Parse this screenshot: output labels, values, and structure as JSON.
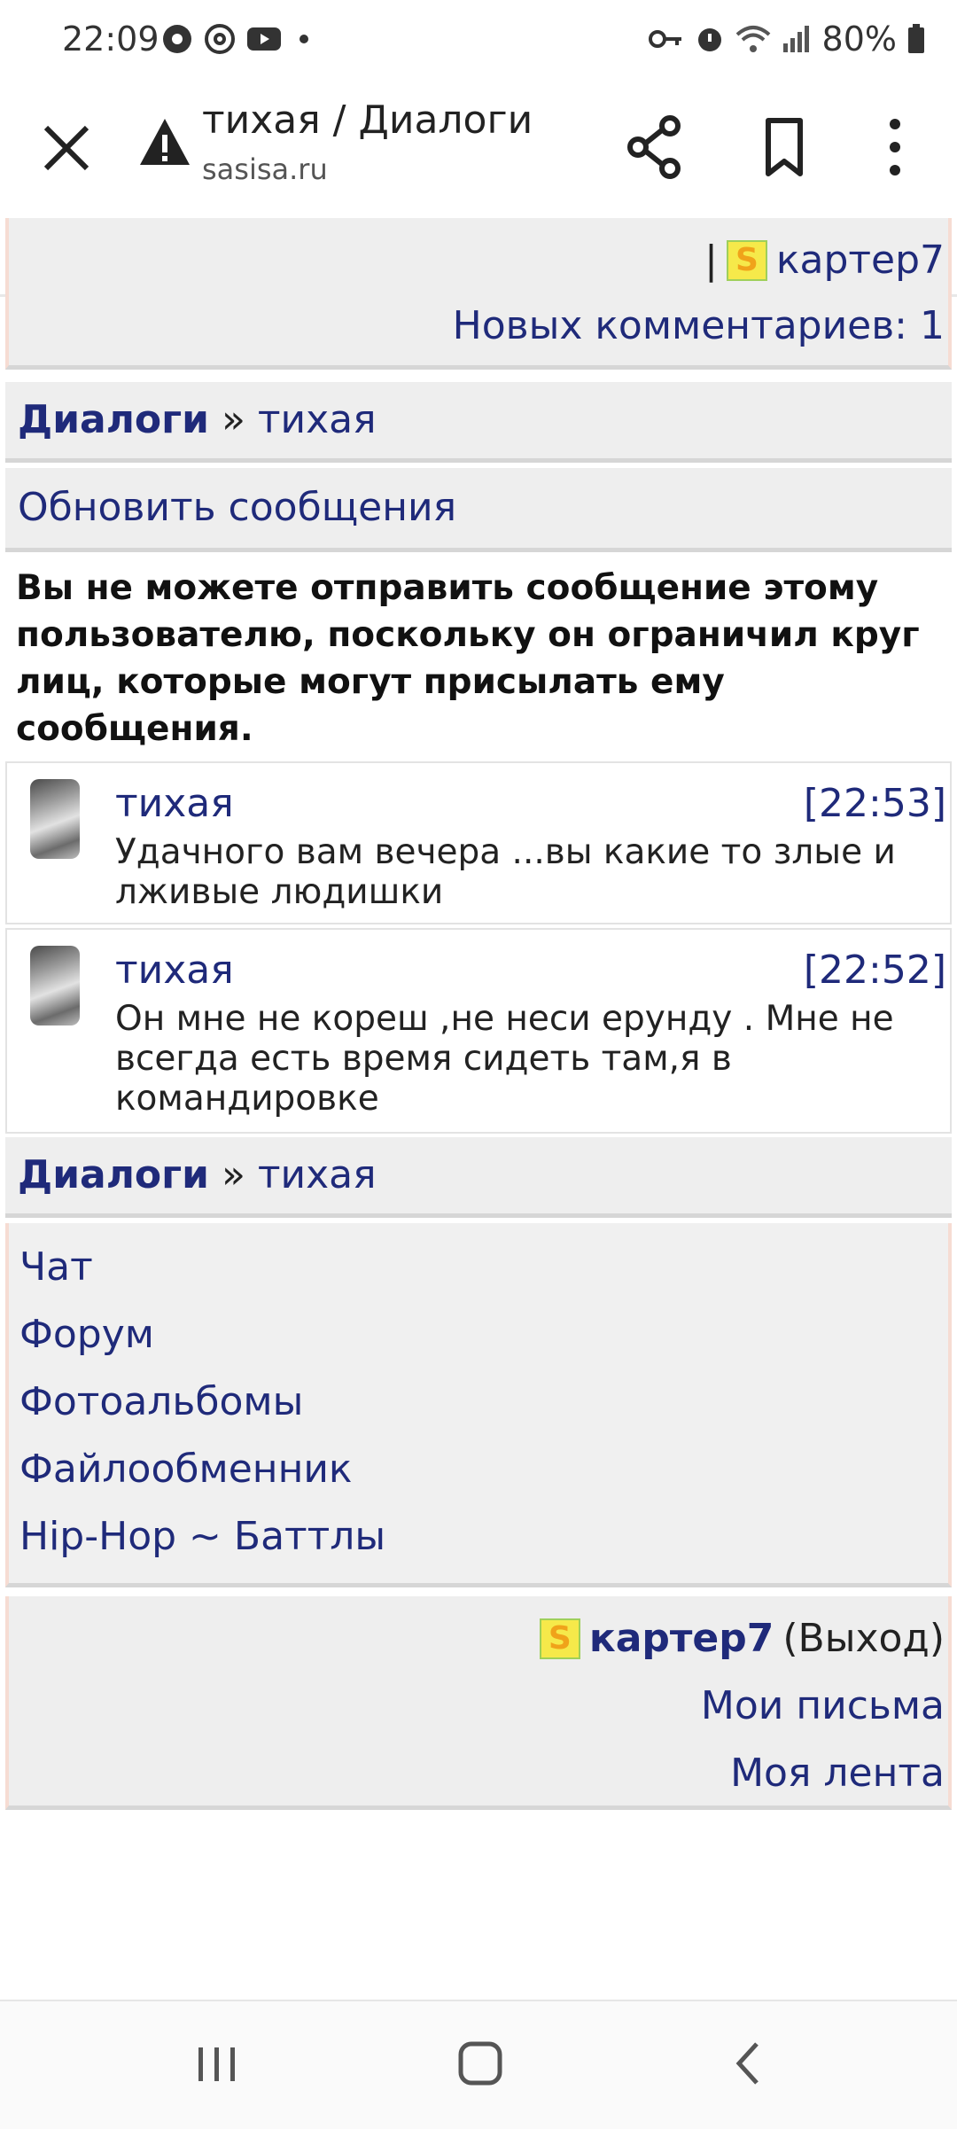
{
  "status_bar": {
    "time": "22:09",
    "battery": "80%",
    "left_icons": [
      "chrome-icon",
      "at-icon",
      "youtube-icon",
      "dot-icon"
    ],
    "right_icons": [
      "key-icon",
      "alarm-icon",
      "wifi-icon",
      "signal-icon",
      "battery-icon"
    ]
  },
  "browser": {
    "title": "тихая / Диалоги",
    "url": "sasisa.ru"
  },
  "header": {
    "separator": "|",
    "badge": "S",
    "username": "картер7",
    "new_comments": "Новых комментариев: 1"
  },
  "breadcrumb": {
    "section": "Диалоги",
    "separator": "»",
    "current": "тихая"
  },
  "refresh_label": "Обновить сообщения",
  "warning_text": "Вы не можете отправить сообщение этому пользователю, поскольку он ограничил круг лиц, которые могут присылать ему сообщения.",
  "messages": [
    {
      "author": "тихая",
      "time": "[22:53]",
      "text": "Удачного вам вечера ...вы какие то злые и лживые людишки"
    },
    {
      "author": "тихая",
      "time": "[22:52]",
      "text": "Он мне не кореш ,не неси ерунду . Мне не всегда есть время сидеть там,я в командировке"
    }
  ],
  "menu": [
    "Чат",
    "Форум",
    "Фотоальбомы",
    "Файлообменник",
    "Hip-Hop ~ Баттлы"
  ],
  "footer": {
    "badge": "S",
    "username": "картер7",
    "exit": "(Выход)",
    "my_letters": "Мои письма",
    "my_feed": "Моя лента"
  },
  "colors": {
    "link": "#1f2a7a",
    "panel": "#eeeeee",
    "panel_border": "#f6dcd3"
  }
}
